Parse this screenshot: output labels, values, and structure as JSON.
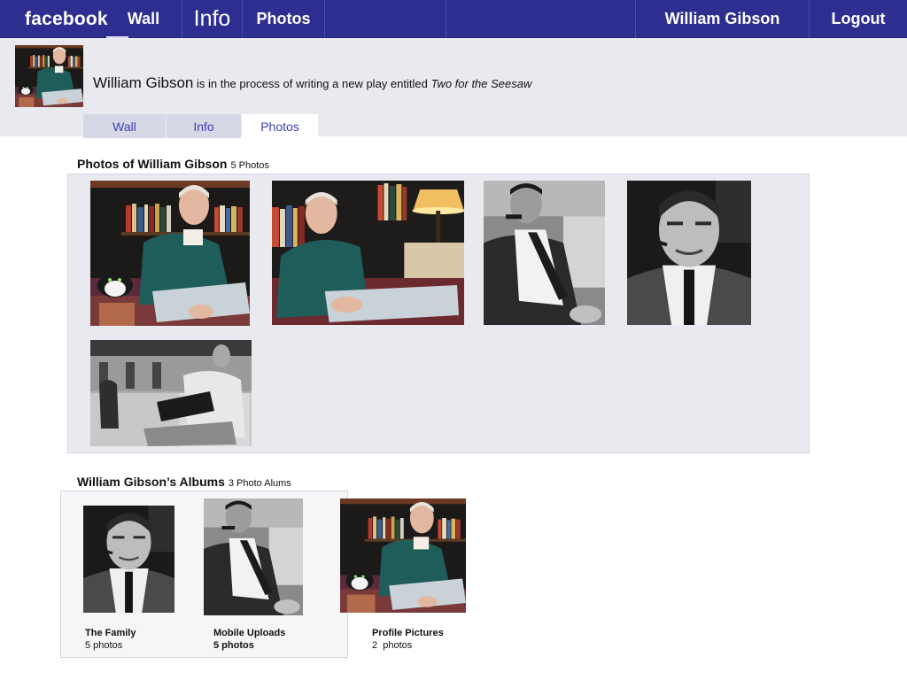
{
  "topbar": {
    "brand": "facebook",
    "nav": [
      "Wall",
      "Info",
      "Photos"
    ],
    "user": "William Gibson",
    "logout": "Logout"
  },
  "profile": {
    "name": "William Gibson",
    "status_pre": " is in the process of writing a new play entitled ",
    "status_title": "Two for the Seesaw",
    "tabs": [
      "Wall",
      "Info",
      "Photos"
    ],
    "active_tab": "Photos"
  },
  "photos_section": {
    "title": "Photos of William Gibson",
    "count": "5 Photos"
  },
  "albums_section": {
    "title": "William Gibson’s Albums",
    "count": "3 Photo Alums",
    "albums": [
      {
        "name": "The Family",
        "count": "5 photos"
      },
      {
        "name": "Mobile Uploads",
        "count": "5 photos"
      },
      {
        "name": "Profile Pictures",
        "count": "2  photos"
      }
    ]
  },
  "colors": {
    "topbar": "#2d2e8f",
    "header_bg": "#e9eaf0",
    "tab_text": "#3b3fb0"
  }
}
